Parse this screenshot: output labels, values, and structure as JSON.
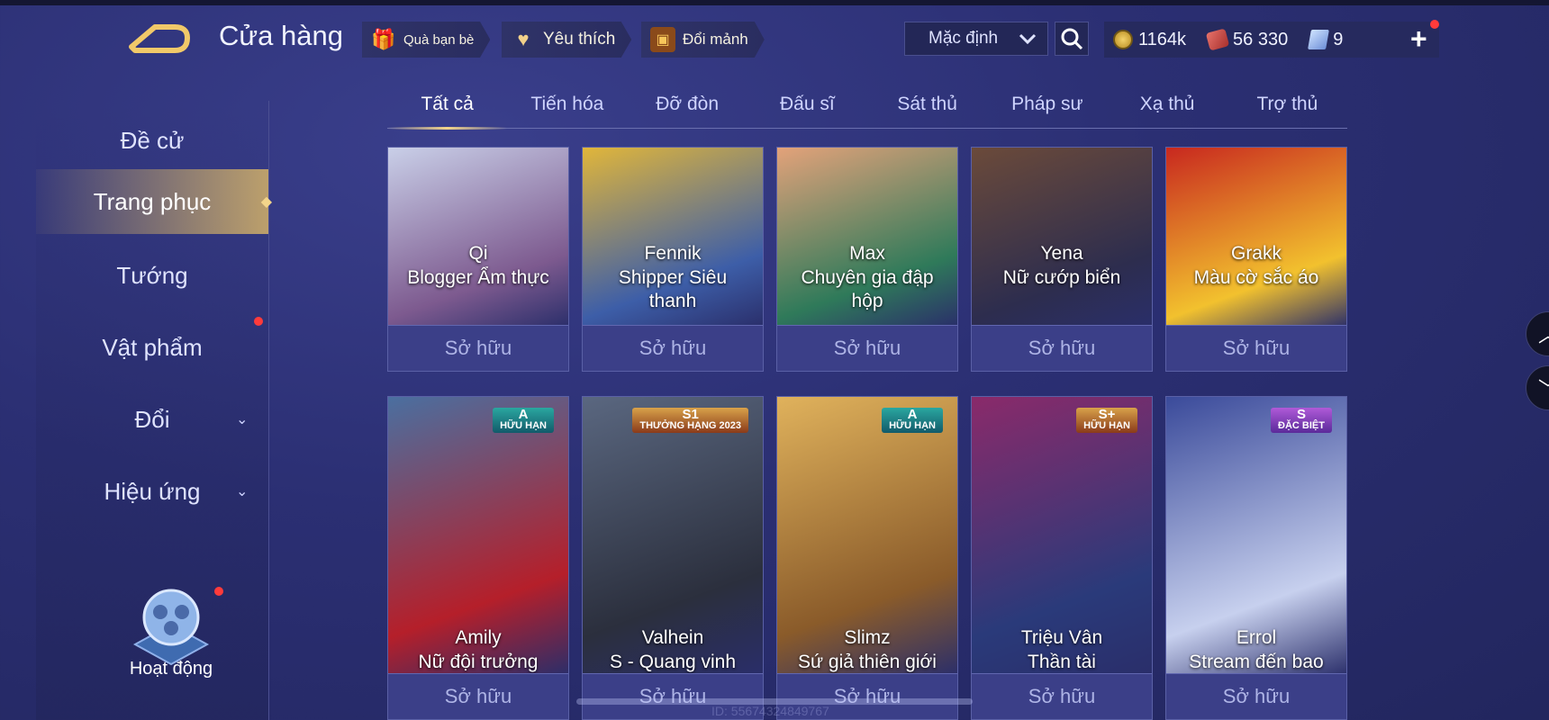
{
  "header": {
    "title": "Cửa hàng",
    "buttons": [
      {
        "label": "Quà bạn bè",
        "icon": "gift-icon"
      },
      {
        "label": "Yêu thích",
        "icon": "heart-icon"
      },
      {
        "label": "Đổi mảnh",
        "icon": "shard-chest-icon"
      }
    ],
    "sort_value": "Mặc định",
    "currency": {
      "gold": "1164k",
      "vouchers": "56 330",
      "tickets": "9"
    }
  },
  "sidebar": {
    "items": [
      {
        "label": "Đề cử"
      },
      {
        "label": "Trang phục"
      },
      {
        "label": "Tướng"
      },
      {
        "label": "Vật phẩm"
      },
      {
        "label": "Đổi"
      },
      {
        "label": "Hiệu ứng"
      }
    ],
    "active": "Trang phục",
    "activity_label": "Hoạt động"
  },
  "tabs": [
    "Tất cả",
    "Tiến hóa",
    "Đỡ đòn",
    "Đấu sĩ",
    "Sát thủ",
    "Pháp sư",
    "Xạ thủ",
    "Trợ thủ"
  ],
  "active_tab": "Tất cả",
  "cards_row1": [
    {
      "hero": "Qi",
      "skin": "Blogger Ẩm thực",
      "status": "Sở hữu",
      "colors": [
        "#c9cfe8",
        "#7d5a8f"
      ]
    },
    {
      "hero": "Fennik",
      "skin": "Shipper Siêu thanh",
      "status": "Sở hữu",
      "colors": [
        "#e1b63a",
        "#3d5ea8"
      ]
    },
    {
      "hero": "Max",
      "skin": "Chuyên gia đập hộp",
      "status": "Sở hữu",
      "colors": [
        "#e3a27a",
        "#2f7a5a"
      ]
    },
    {
      "hero": "Yena",
      "skin": "Nữ cướp biển",
      "status": "Sở hữu",
      "colors": [
        "#6b4a3a",
        "#2d2d4e"
      ]
    },
    {
      "hero": "Grakk",
      "skin": "Màu cờ sắc áo",
      "status": "Sở hữu",
      "colors": [
        "#c8281f",
        "#f2c12e"
      ]
    }
  ],
  "cards_row2": [
    {
      "hero": "Amily",
      "skin": "Nữ đội trưởng",
      "status": "Sở hữu",
      "badge": {
        "top": "A",
        "bottom": "HỮU HẠN"
      },
      "colors": [
        "#4a6fa0",
        "#b51f2a"
      ]
    },
    {
      "hero": "Valhein",
      "skin": "S - Quang vinh",
      "status": "Sở hữu",
      "badge": {
        "top": "S1",
        "bottom": "THƯỞNG HẠNG 2023"
      },
      "colors": [
        "#5a6780",
        "#2b2f3d"
      ]
    },
    {
      "hero": "Slimz",
      "skin": "Sứ giả thiên giới",
      "status": "Sở hữu",
      "badge": {
        "top": "A",
        "bottom": "HỮU HẠN"
      },
      "colors": [
        "#e0b25c",
        "#8a5b2a"
      ]
    },
    {
      "hero": "Triệu Vân",
      "skin": "Thần tài",
      "status": "Sở hữu",
      "badge": {
        "top": "S+",
        "bottom": "HỮU HẠN"
      },
      "colors": [
        "#8a2a6a",
        "#2a3a7a"
      ]
    },
    {
      "hero": "Errol",
      "skin": "Stream đến bao giờ?",
      "status": "Sở hữu",
      "badge": {
        "top": "S",
        "bottom": "ĐẶC BIỆT"
      },
      "colors": [
        "#3a4a9a",
        "#c7d0ee"
      ]
    }
  ],
  "footer_uid": "ID: 55674324849767"
}
